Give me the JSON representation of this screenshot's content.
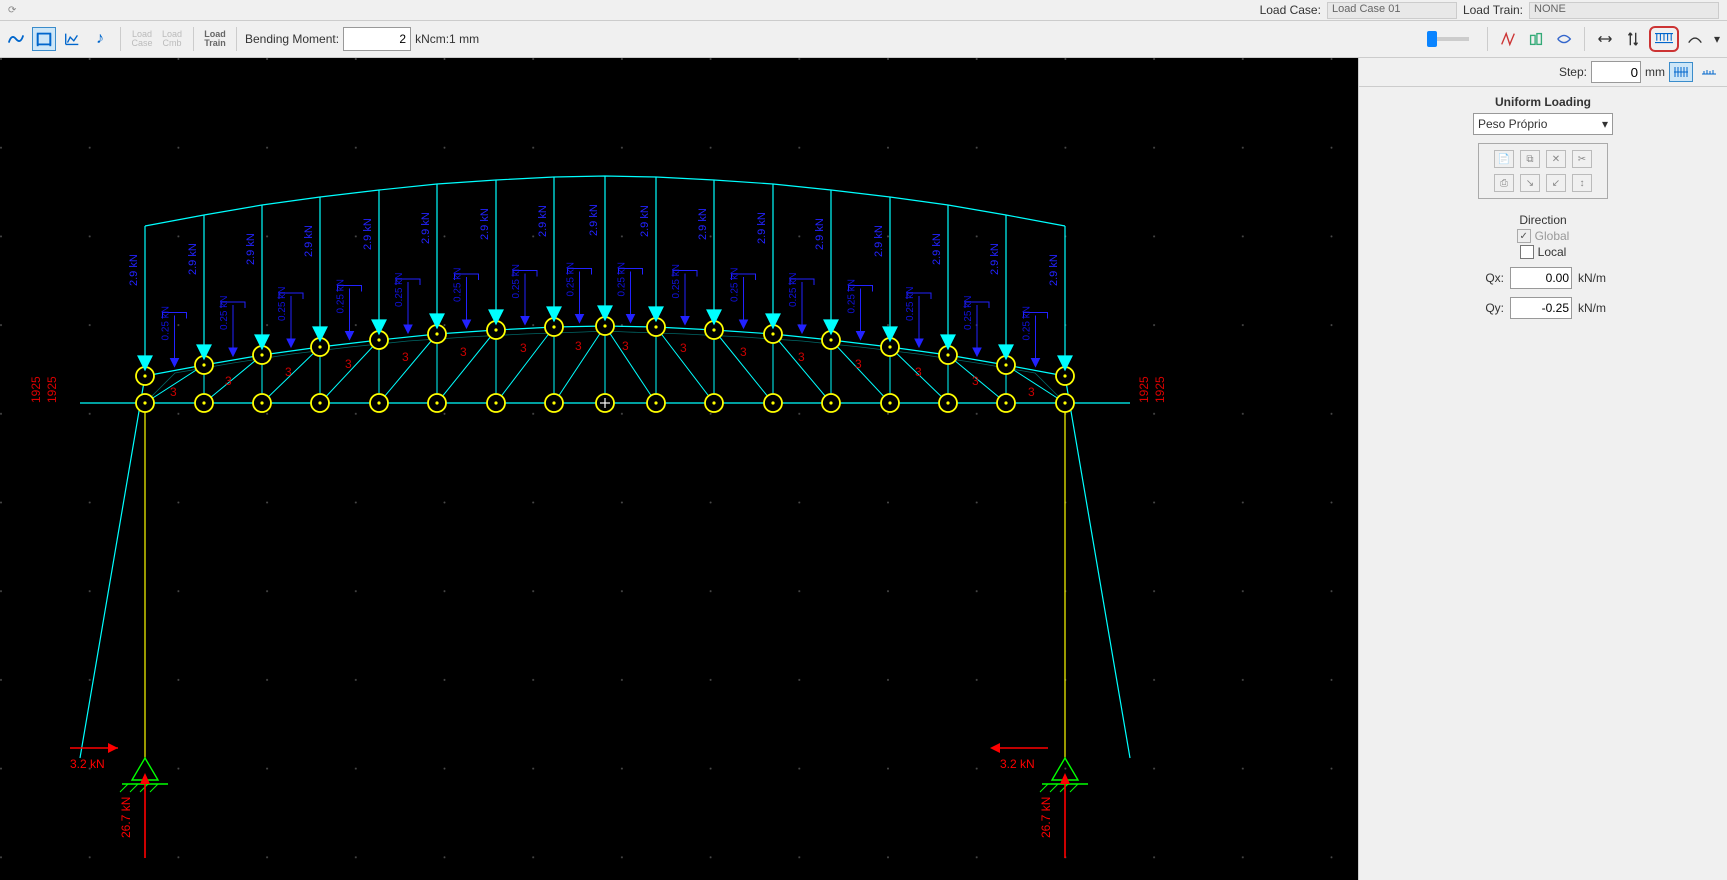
{
  "topbar": {
    "load_case_label": "Load Case:",
    "load_case_value": "Load Case 01",
    "load_train_label": "Load Train:",
    "load_train_value": "NONE"
  },
  "toolbar": {
    "bending_moment_label": "Bending Moment:",
    "bending_moment_value": "2",
    "bending_moment_unit": "kNcm:1 mm",
    "load_case_btn": "Load\nCase",
    "load_cmb_btn": "Load\nCmb",
    "load_train_btn": "Load\nTrain",
    "step_label": "Step:",
    "step_value": "0",
    "step_unit": "mm"
  },
  "side": {
    "title": "Uniform Loading",
    "dropdown_value": "Peso Próprio",
    "direction_label": "Direction",
    "global_label": "Global",
    "local_label": "Local",
    "qx_label": "Qx:",
    "qx_value": "0.00",
    "qy_label": "Qy:",
    "qy_value": "-0.25",
    "q_unit": "kN/m"
  },
  "model": {
    "point_loads": [
      "2.9 kN",
      "0.25 kN",
      "2.9 kN",
      "0.25 kN",
      "2.9 kN",
      "0.25 kN",
      "2.9 kN",
      "0.25 kN",
      "2.9 kN",
      "0.25 kN",
      "2.9 kN",
      "0.25 kN",
      "2.9 kN",
      "0.25 kN",
      "2.9 kN",
      "0.25 kN",
      "2.9 kN",
      "2.9 kN",
      "0.25 kN",
      "2.9 kN",
      "0.25 kN",
      "2.9 kN",
      "0.25 kN",
      "2.9 kN",
      "0.25 kN",
      "2.9 kN",
      "0.25 kN",
      "2.9 kN",
      "0.25 kN",
      "2.9 kN",
      "0.25 kN",
      "2.9 kN",
      "0.25 kN",
      "2.9 kN"
    ],
    "support_reaction_h": "3.2 kN",
    "support_reaction_v": "26.7 kN",
    "dim_label": "1925",
    "section_label": "3"
  }
}
